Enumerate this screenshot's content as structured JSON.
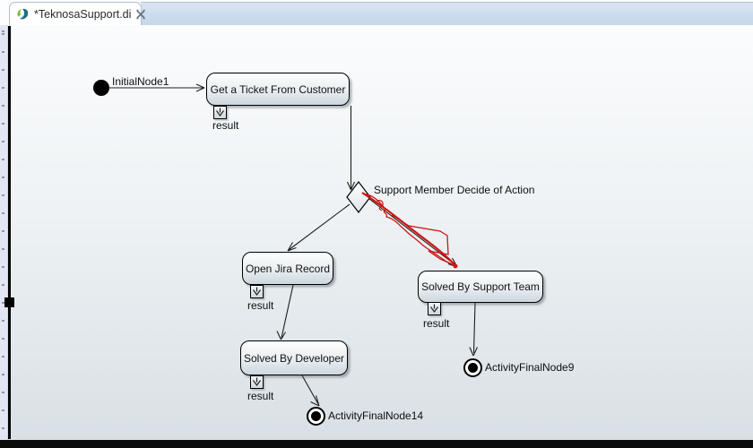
{
  "tab": {
    "title": "*TeknosaSupport.di"
  },
  "diagram": {
    "initial_node": {
      "label": "InitialNode1"
    },
    "decision": {
      "label": "Support Member Decide of Action"
    },
    "actions": [
      {
        "label": "Get a Ticket From Customer",
        "pin_label": "result"
      },
      {
        "label": "Open Jira Record",
        "pin_label": "result"
      },
      {
        "label": "Solved By Developer",
        "pin_label": "result"
      },
      {
        "label": "Solved By Support Team",
        "pin_label": "result"
      }
    ],
    "final_nodes": [
      {
        "label": "ActivityFinalNode14"
      },
      {
        "label": "ActivityFinalNode9"
      }
    ]
  },
  "colors": {
    "annotation_red": "#cf1414",
    "tab_bar_blue": "#cbdcee",
    "canvas_top": "#fbfcfd",
    "canvas_bottom": "#d9e0e5"
  }
}
